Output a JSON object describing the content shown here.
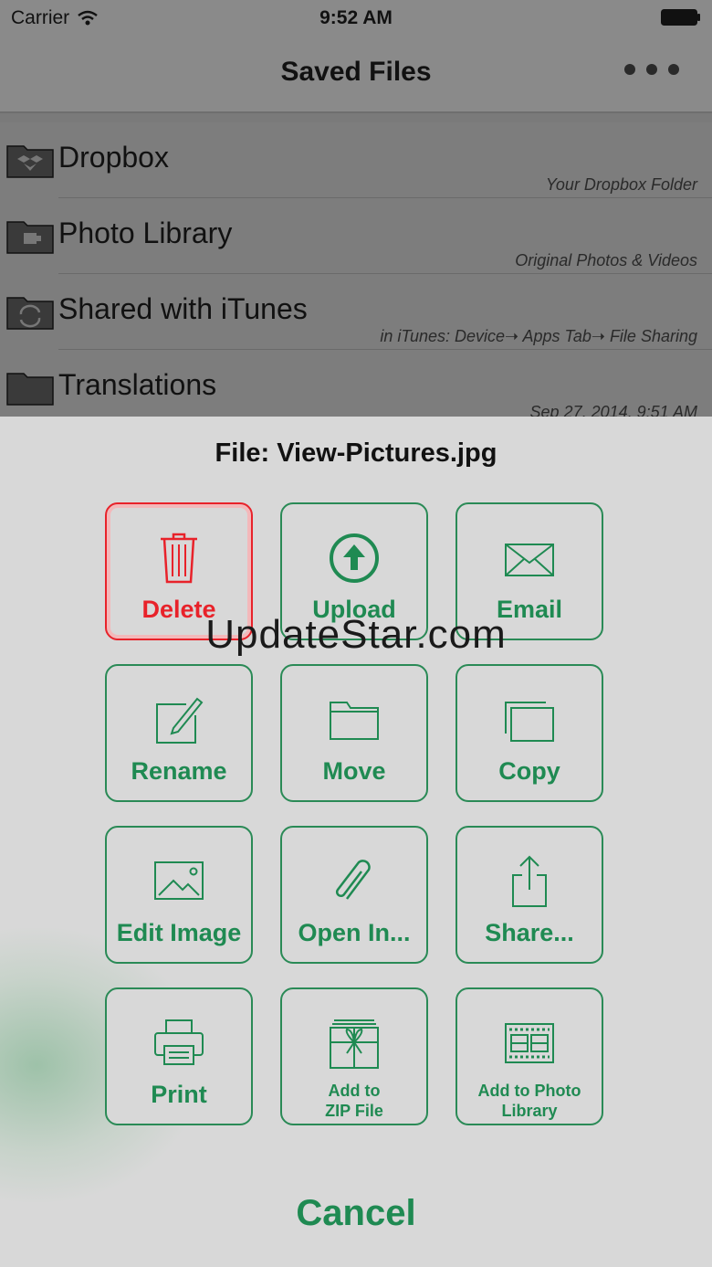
{
  "status_bar": {
    "carrier": "Carrier",
    "time": "9:52 AM"
  },
  "nav": {
    "title": "Saved Files",
    "more_icon": "ellipsis-icon"
  },
  "folders": [
    {
      "name": "Dropbox",
      "subtitle": "Your Dropbox Folder",
      "icon": "dropbox-folder-icon"
    },
    {
      "name": "Photo Library",
      "subtitle": "Original Photos & Videos",
      "icon": "photo-folder-icon"
    },
    {
      "name": "Shared with iTunes",
      "subtitle": "in iTunes: Device➝ Apps Tab➝ File Sharing",
      "icon": "sync-folder-icon"
    },
    {
      "name": "Translations",
      "subtitle": "Sep 27, 2014, 9:51 AM",
      "icon": "folder-icon"
    }
  ],
  "sheet": {
    "file_title": "File: View-Pictures.jpg",
    "actions": [
      {
        "label": "Delete",
        "icon": "trash-icon"
      },
      {
        "label": "Upload",
        "icon": "upload-icon"
      },
      {
        "label": "Email",
        "icon": "envelope-icon"
      },
      {
        "label": "Rename",
        "icon": "edit-icon"
      },
      {
        "label": "Move",
        "icon": "folder-icon"
      },
      {
        "label": "Copy",
        "icon": "copy-icon"
      },
      {
        "label": "Edit Image",
        "icon": "image-icon"
      },
      {
        "label": "Open In...",
        "icon": "paperclip-icon"
      },
      {
        "label": "Share...",
        "icon": "share-icon"
      },
      {
        "label": "Print",
        "icon": "printer-icon"
      },
      {
        "label": "Add to\nZIP File",
        "icon": "gift-box-icon"
      },
      {
        "label": "Add to Photo Library",
        "icon": "film-icon"
      }
    ],
    "cancel_label": "Cancel"
  },
  "watermark": "UpdateStar.com",
  "colors": {
    "accent_green": "#1f8a52",
    "delete_red": "#e8222a",
    "dim_overlay": "#7d7d7d"
  }
}
